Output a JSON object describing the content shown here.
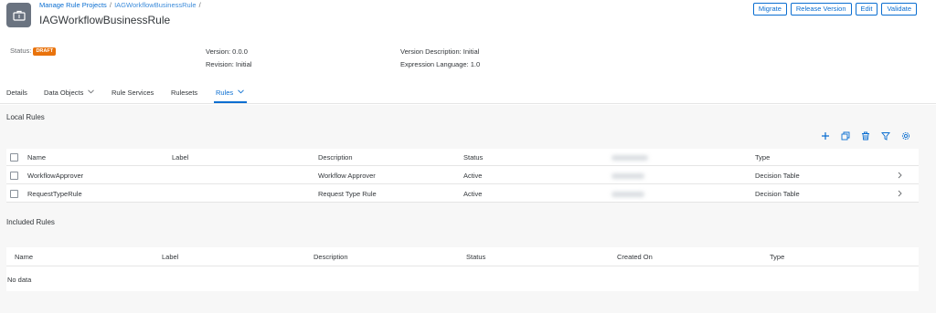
{
  "header": {
    "breadcrumb": [
      {
        "label": "Manage Rule Projects"
      },
      {
        "label": "IAGWorkflowBusinessRule"
      }
    ],
    "breadcrumb_sep": "/",
    "title": "IAGWorkflowBusinessRule",
    "object_icon": "briefcase-icon",
    "actions": {
      "migrate": "Migrate",
      "release_version": "Release Version",
      "edit": "Edit",
      "validate": "Validate"
    }
  },
  "attributes": {
    "status_label": "Status:",
    "status_value": "DRAFT",
    "status_color": "#e9730c",
    "version": "Version: 0.0.0",
    "revision": "Revision: Initial",
    "version_description": "Version Description: Initial",
    "expression_language": "Expression Language: 1.0"
  },
  "tabs": {
    "details": "Details",
    "data_objects": "Data Objects",
    "rule_services": "Rule Services",
    "rulesets": "Rulesets",
    "rules": "Rules",
    "active": "Rules"
  },
  "local_rules": {
    "title": "Local Rules",
    "toolbar_icons": [
      "add-icon",
      "copy-icon",
      "delete-icon",
      "filter-icon",
      "settings-icon"
    ],
    "columns": {
      "name": "Name",
      "label": "Label",
      "description": "Description",
      "status": "Status",
      "type": "Type"
    },
    "rows": [
      {
        "name": "WorkflowApprover",
        "label": "",
        "description": "Workflow Approver",
        "status": "Active",
        "type": "Decision Table"
      },
      {
        "name": "RequestTypeRule",
        "label": "",
        "description": "Request Type Rule",
        "status": "Active",
        "type": "Decision Table"
      }
    ]
  },
  "included_rules": {
    "title": "Included Rules",
    "columns": {
      "name": "Name",
      "label": "Label",
      "description": "Description",
      "status": "Status",
      "created_on": "Created On",
      "type": "Type"
    },
    "no_data": "No data"
  },
  "colors": {
    "accent": "#0a6ed1",
    "text": "#32363a",
    "background": "#f7f7f7"
  }
}
